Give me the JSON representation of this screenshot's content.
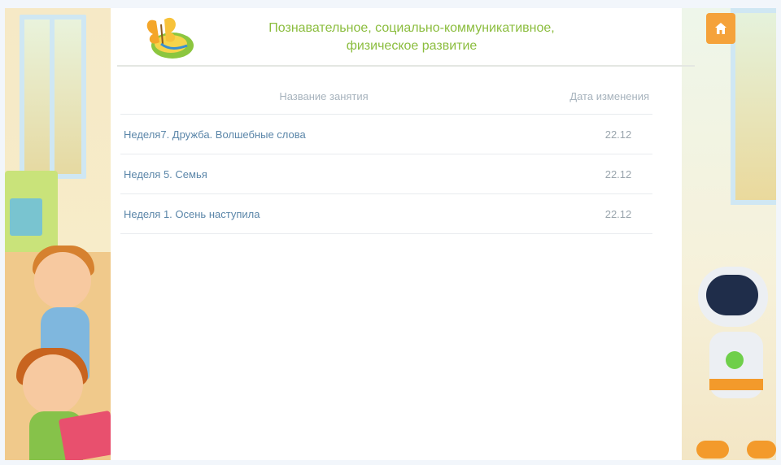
{
  "header": {
    "title_line1": "Познавательное, социально-коммуникативное,",
    "title_line2": "физическое развитие"
  },
  "table": {
    "columns": [
      "Название занятия",
      "Дата изменения"
    ],
    "rows": [
      {
        "name": "Неделя7. Дружба. Волшебные слова",
        "date": "22.12"
      },
      {
        "name": "Неделя 5. Семья",
        "date": "22.12"
      },
      {
        "name": "Неделя 1. Осень наступила",
        "date": "22.12"
      }
    ]
  },
  "colors": {
    "title": "#8bbd3e",
    "link": "#5b86a9",
    "accent": "#f5a23a"
  },
  "icons": {
    "logo": "butterfly-logo-icon",
    "home": "home-icon"
  }
}
